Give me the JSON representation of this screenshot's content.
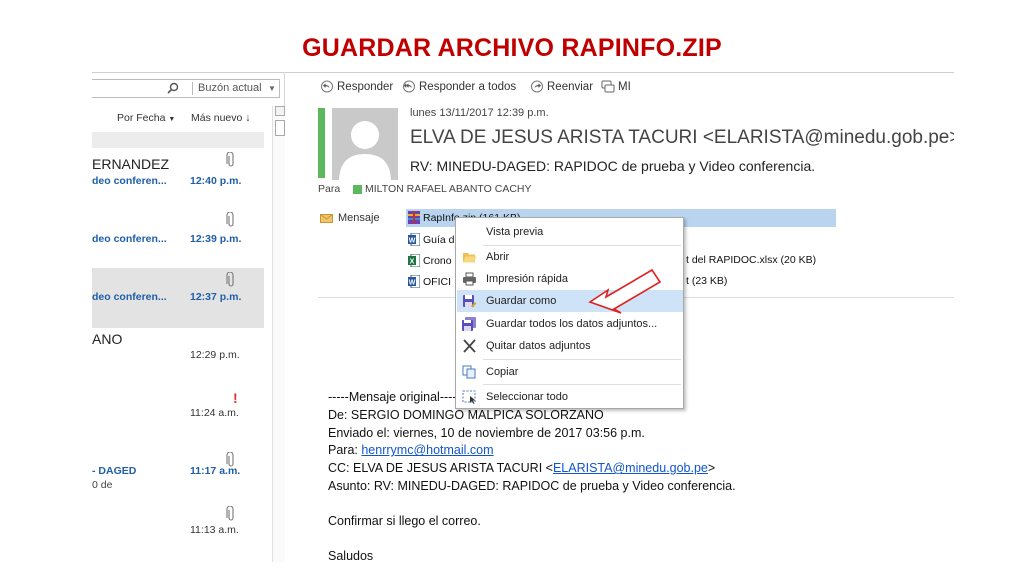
{
  "slide": {
    "title": "GUARDAR ARCHIVO RAPINFO.ZIP"
  },
  "search": {
    "scope": "Buzón actual"
  },
  "sort": {
    "by": "Por Fecha",
    "order": "Más nuevo"
  },
  "messages": [
    {
      "sender": "ERNANDEZ",
      "subject": "deo conferen...",
      "time": "12:40 p.m."
    },
    {
      "subject": "deo conferen...",
      "time": "12:39 p.m."
    },
    {
      "subject": "deo conferen...",
      "time": "12:37 p.m."
    },
    {
      "sender": "ANO",
      "time": "12:29 p.m."
    },
    {
      "time": "11:24 a.m.",
      "important": "!"
    },
    {
      "subject": "- DAGED",
      "preview": "0 de",
      "time": "11:17 a.m."
    },
    {
      "time": "11:13 a.m."
    }
  ],
  "toolbar": {
    "reply": "Responder",
    "reply_all": "Responder a todos",
    "forward": "Reenviar",
    "im": "MI"
  },
  "email": {
    "date": "lunes 13/11/2017 12:39 p.m.",
    "from": "ELVA DE JESUS ARISTA TACURI <ELARISTA@minedu.gob.pe>",
    "subject": "RV: MINEDU-DAGED: RAPIDOC de prueba y Video conferencia.",
    "to_label": "Para",
    "to": "MILTON RAFAEL ABANTO CACHY"
  },
  "attachments": {
    "label": "Mensaje",
    "items": [
      "RapInfo.zip (161 KB)",
      "Guía d",
      "Crono",
      "OFICI"
    ],
    "right_texts": [
      "t del RAPIDOC.xlsx (20 KB)",
      "t (23 KB)"
    ]
  },
  "context_menu": {
    "items": [
      "Vista previa",
      "Abrir",
      "Impresión rápida",
      "Guardar como",
      "Guardar todos los datos adjuntos...",
      "Quitar datos adjuntos",
      "Copiar",
      "Seleccionar todo"
    ]
  },
  "body": {
    "original": "-----Mensaje original-----",
    "de": "De: SERGIO DOMINGO MALPICA SOLORZANO",
    "enviado": "Enviado el: viernes, 10 de noviembre de 2017 03:56 p.m.",
    "para_label": "Para: ",
    "para_email": "henrrymc@hotmail.com",
    "cc_label": "CC: ELVA DE JESUS ARISTA TACURI <",
    "cc_email": "ELARISTA@minedu.gob.pe",
    "cc_end": ">",
    "asunto": "Asunto: RV: MINEDU-DAGED: RAPIDOC de prueba y Video conferencia.",
    "line1": "Confirmar si llego el correo.",
    "line2": "Saludos"
  },
  "colors": {
    "title": "#c00000",
    "accent_green": "#5cb85c",
    "link": "#1155cc",
    "highlight": "#cfe3f8",
    "arrow": "#e02020"
  }
}
